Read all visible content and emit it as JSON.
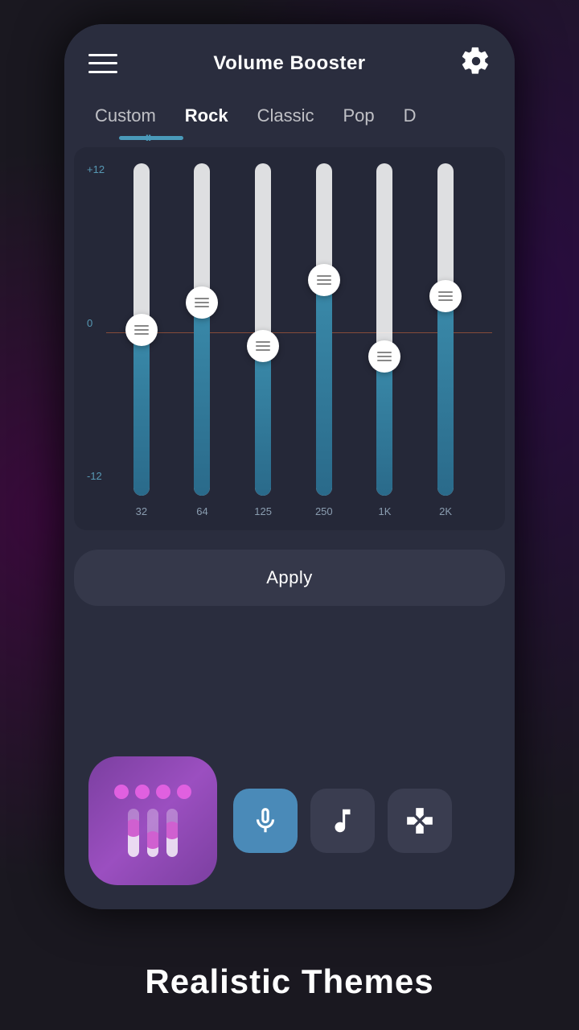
{
  "app": {
    "title": "Volume Booster"
  },
  "tabs": [
    {
      "label": "Custom",
      "active": false
    },
    {
      "label": "Rock",
      "active": true
    },
    {
      "label": "Classic",
      "active": false
    },
    {
      "label": "Pop",
      "active": false
    },
    {
      "label": "D",
      "active": false
    }
  ],
  "eq": {
    "y_labels": [
      "+12",
      "0",
      "-12"
    ],
    "sliders": [
      {
        "freq": "32",
        "position": 0.5,
        "fill": 0.5
      },
      {
        "freq": "64",
        "position": 0.42,
        "fill": 0.58
      },
      {
        "freq": "125",
        "position": 0.55,
        "fill": 0.45
      },
      {
        "freq": "250",
        "position": 0.35,
        "fill": 0.65
      },
      {
        "freq": "1K",
        "position": 0.58,
        "fill": 0.42
      },
      {
        "freq": "2K",
        "position": 0.4,
        "fill": 0.6
      }
    ]
  },
  "apply_button": {
    "label": "Apply"
  },
  "bottom_icons": [
    {
      "name": "microphone",
      "active": true
    },
    {
      "name": "music-note",
      "active": false
    },
    {
      "name": "gamepad",
      "active": false
    }
  ],
  "bottom_text": "Realistic Themes"
}
